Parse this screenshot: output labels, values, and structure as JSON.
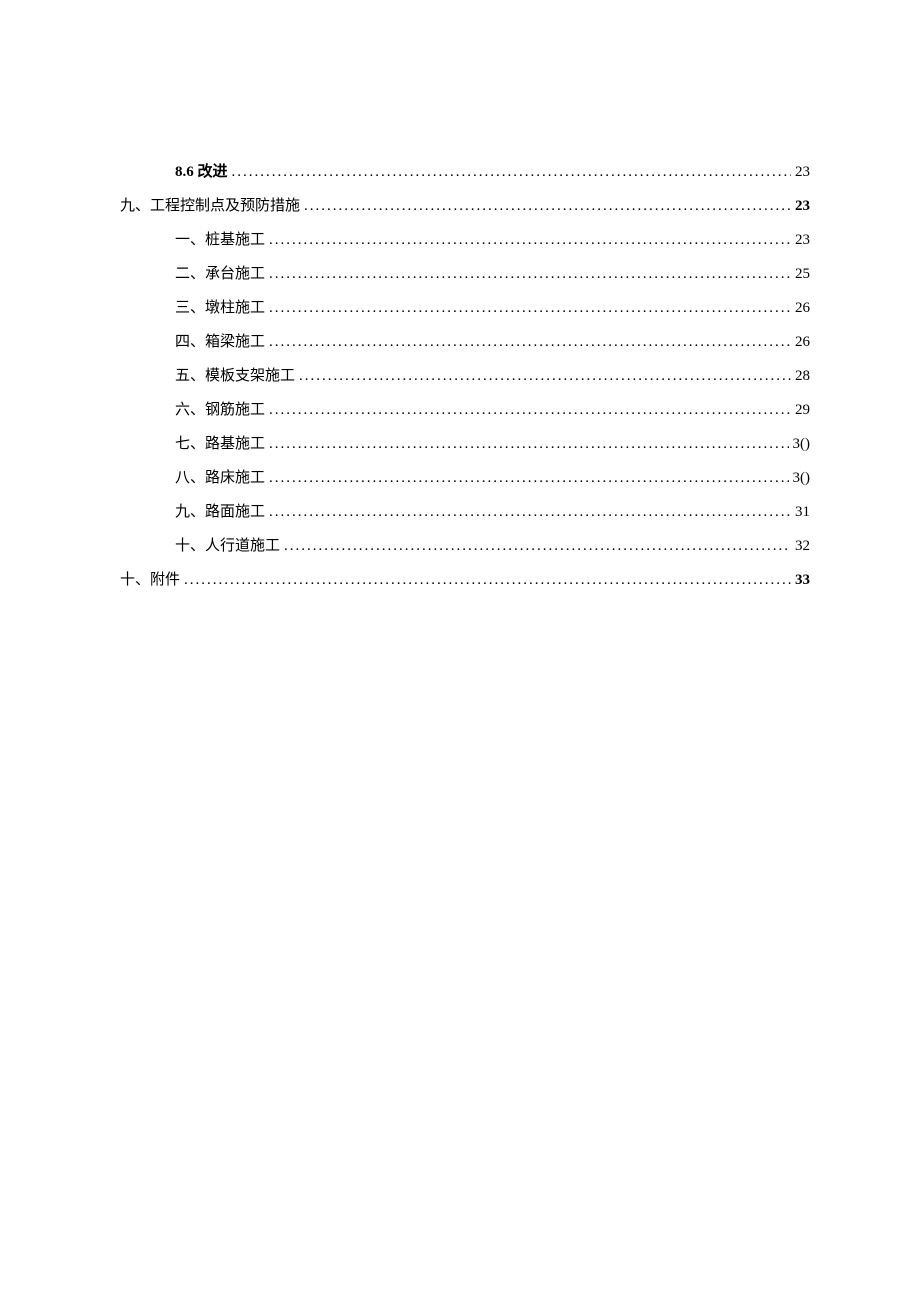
{
  "toc": [
    {
      "label": "8.6 改进",
      "page": "23",
      "indent": "indent-0",
      "labelBold": true,
      "pageBold": false
    },
    {
      "label": "九、工程控制点及预防措施",
      "page": "23",
      "indent": "indent-1",
      "labelBold": false,
      "pageBold": true
    },
    {
      "label": "一、桩基施工",
      "page": "23",
      "indent": "indent-2",
      "labelBold": false,
      "pageBold": false
    },
    {
      "label": "二、承台施工",
      "page": "25",
      "indent": "indent-2",
      "labelBold": false,
      "pageBold": false
    },
    {
      "label": "三、墩柱施工",
      "page": "26",
      "indent": "indent-2",
      "labelBold": false,
      "pageBold": false
    },
    {
      "label": "四、箱梁施工",
      "page": "26",
      "indent": "indent-2",
      "labelBold": false,
      "pageBold": false
    },
    {
      "label": "五、模板支架施工",
      "page": "28",
      "indent": "indent-2",
      "labelBold": false,
      "pageBold": false
    },
    {
      "label": "六、钢筋施工",
      "page": "29",
      "indent": "indent-2",
      "labelBold": false,
      "pageBold": false
    },
    {
      "label": "七、路基施工",
      "page": "3()",
      "indent": "indent-2",
      "labelBold": false,
      "pageBold": false
    },
    {
      "label": "八、路床施工",
      "page": "3()",
      "indent": "indent-2",
      "labelBold": false,
      "pageBold": false
    },
    {
      "label": "九、路面施工",
      "page": "31",
      "indent": "indent-2",
      "labelBold": false,
      "pageBold": false
    },
    {
      "label": "十、人行道施工",
      "page": "32",
      "indent": "indent-2",
      "labelBold": false,
      "pageBold": false
    },
    {
      "label": "十、附件",
      "page": "33",
      "indent": "indent-3",
      "labelBold": false,
      "pageBold": true
    }
  ]
}
